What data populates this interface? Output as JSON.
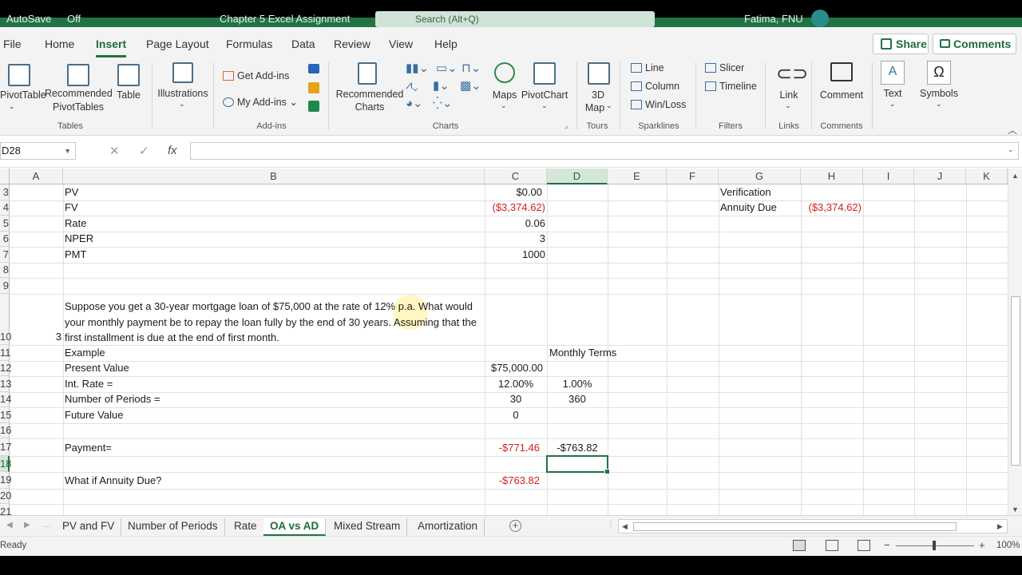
{
  "titlebar": {
    "autosave": "AutoSave",
    "autosave_state": "Off",
    "file_title": "Chapter 5 Excel Assignment",
    "search_placeholder": "Search (Alt+Q)",
    "user": "Fatima, FNU"
  },
  "menu": {
    "tabs": [
      "File",
      "Home",
      "Insert",
      "Page Layout",
      "Formulas",
      "Data",
      "Review",
      "View",
      "Help"
    ],
    "active": "Insert",
    "share": "Share",
    "comments": "Comments"
  },
  "ribbon": {
    "tables": {
      "pivottable": "PivotTable",
      "recommended_l1": "Recommended",
      "recommended_l2": "PivotTables",
      "table": "Table",
      "label": "Tables"
    },
    "illustrations": "Illustrations",
    "addins": {
      "get": "Get Add-ins",
      "my": "My Add-ins",
      "label": "Add-ins"
    },
    "charts": {
      "recommended_l1": "Recommended",
      "recommended_l2": "Charts",
      "maps": "Maps",
      "pivotchart": "PivotChart",
      "label": "Charts"
    },
    "tours": {
      "map_l1": "3D",
      "map_l2": "Map",
      "label": "Tours"
    },
    "sparklines": {
      "line": "Line",
      "column": "Column",
      "winloss": "Win/Loss",
      "label": "Sparklines"
    },
    "filters": {
      "slicer": "Slicer",
      "timeline": "Timeline",
      "label": "Filters"
    },
    "links": {
      "link": "Link",
      "label": "Links"
    },
    "comments": {
      "comment": "Comment",
      "label": "Comments"
    },
    "text": "Text",
    "symbols": "Symbols"
  },
  "formula_bar": {
    "namebox": "D28",
    "formula": ""
  },
  "columns": [
    "A",
    "B",
    "C",
    "D",
    "E",
    "F",
    "G",
    "H",
    "I",
    "J",
    "K"
  ],
  "selected_column": "D",
  "rows": [
    "3",
    "4",
    "5",
    "6",
    "7",
    "8",
    "9",
    "10",
    "11",
    "12",
    "13",
    "14",
    "15",
    "16",
    "17",
    "18",
    "19",
    "20",
    "21"
  ],
  "selected_row": "18",
  "cells": {
    "B3": "PV",
    "C3": "$0.00",
    "B4": "FV",
    "C4": "($3,374.62)",
    "B5": "Rate",
    "C5": "0.06",
    "B6": "NPER",
    "C6": "3",
    "B7": "PMT",
    "C7": "1000",
    "G3": "Verification",
    "G4": "Annuity Due",
    "H4": "($3,374.62)",
    "A10": "3",
    "B10": "Suppose you get a 30-year mortgage loan of $75,000  at the rate of 12% p.a. What would your monthly payment be to repay the loan fully by the end of 30 years. Assuming that the first installment is due at the end of first month.",
    "B11": "Example",
    "D11": "Monthly Terms",
    "B12": "Present Value",
    "C12": "$75,000.00",
    "B13": "Int. Rate =",
    "C13": "12.00%",
    "D13": "1.00%",
    "B14": "Number of Periods =",
    "C14": "30",
    "D14": "360",
    "B15": "Future Value",
    "C15": "0",
    "B17": "Payment=",
    "C17": "-$771.46",
    "D17": "-$763.82",
    "B19": "What if Annuity Due?",
    "C19": "-$763.82"
  },
  "sheets": [
    "PV and FV",
    "Number of Periods",
    "Rate",
    "OA vs AD",
    "Mixed Stream",
    "Amortization"
  ],
  "active_sheet": "OA vs AD",
  "status": {
    "ready": "Ready",
    "zoom": "100%"
  },
  "colors": {
    "accent": "#217346",
    "negative": "#d42020"
  }
}
